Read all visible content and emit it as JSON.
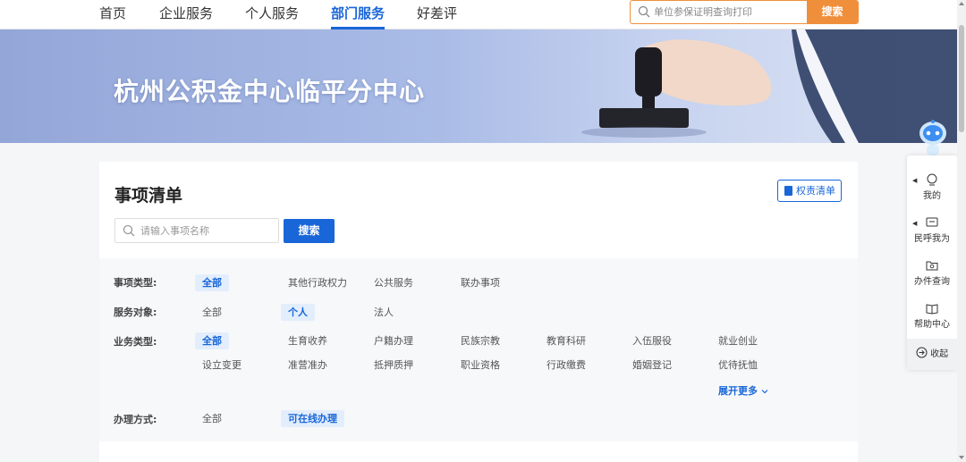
{
  "nav": {
    "items": [
      {
        "label": "首页"
      },
      {
        "label": "企业服务"
      },
      {
        "label": "个人服务"
      },
      {
        "label": "部门服务",
        "active": true
      },
      {
        "label": "好差评"
      }
    ],
    "search_placeholder": "单位参保证明查询打印",
    "search_button": "搜索"
  },
  "banner": {
    "title": "杭州公积金中心临平分中心"
  },
  "main": {
    "title": "事项清单",
    "power_list_button": "权责清单",
    "search_placeholder": "请输入事项名称",
    "search_button": "搜索",
    "filters": {
      "matter_type": {
        "label": "事项类型:",
        "options": [
          "全部",
          "其他行政权力",
          "公共服务",
          "联办事项"
        ],
        "active": "全部"
      },
      "service_object": {
        "label": "服务对象:",
        "options": [
          "全部",
          "个人",
          "法人"
        ],
        "active": "个人"
      },
      "business_type": {
        "label": "业务类型:",
        "options": [
          "全部",
          "生育收养",
          "户籍办理",
          "民族宗教",
          "教育科研",
          "入伍服役",
          "就业创业",
          "设立变更",
          "准营准办",
          "抵押质押",
          "职业资格",
          "行政缴费",
          "婚姻登记",
          "优待抚恤"
        ],
        "active": "全部",
        "expand_label": "展开更多"
      },
      "handling_method": {
        "label": "办理方式:",
        "options": [
          "全部",
          "可在线办理"
        ],
        "active": "可在线办理"
      }
    }
  },
  "float_bar": {
    "items": [
      {
        "label": "我的",
        "icon": "user-icon"
      },
      {
        "label": "民呼我为",
        "icon": "message-icon"
      },
      {
        "label": "办件查询",
        "icon": "folder-search-icon"
      },
      {
        "label": "帮助中心",
        "icon": "book-icon"
      }
    ],
    "collapse_label": "收起"
  },
  "colors": {
    "primary": "#1966d8",
    "accent_orange": "#f08f3b"
  }
}
